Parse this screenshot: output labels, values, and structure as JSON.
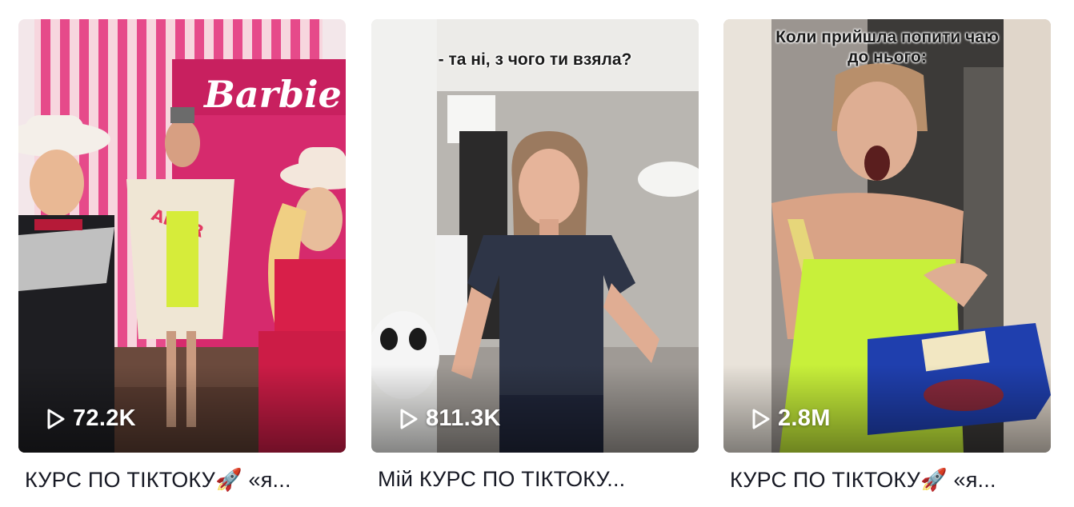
{
  "videos": [
    {
      "views": "72.2K",
      "title": "КУРС ПО ТІКТОКУ🚀 «я...",
      "sign_text": "Barbie",
      "jacket_text": "AMOR",
      "overlay_caption": ""
    },
    {
      "views": "811.3K",
      "title": "Мій КУРС ПО ТІКТОКУ...",
      "overlay_caption": "- та ні, з чого ти взяла?"
    },
    {
      "views": "2.8M",
      "title": "КУРС ПО ТІКТОКУ🚀 «я...",
      "overlay_caption": "Коли прийшла попити чаю до нього:"
    }
  ],
  "icons": {
    "views": "play-icon"
  }
}
